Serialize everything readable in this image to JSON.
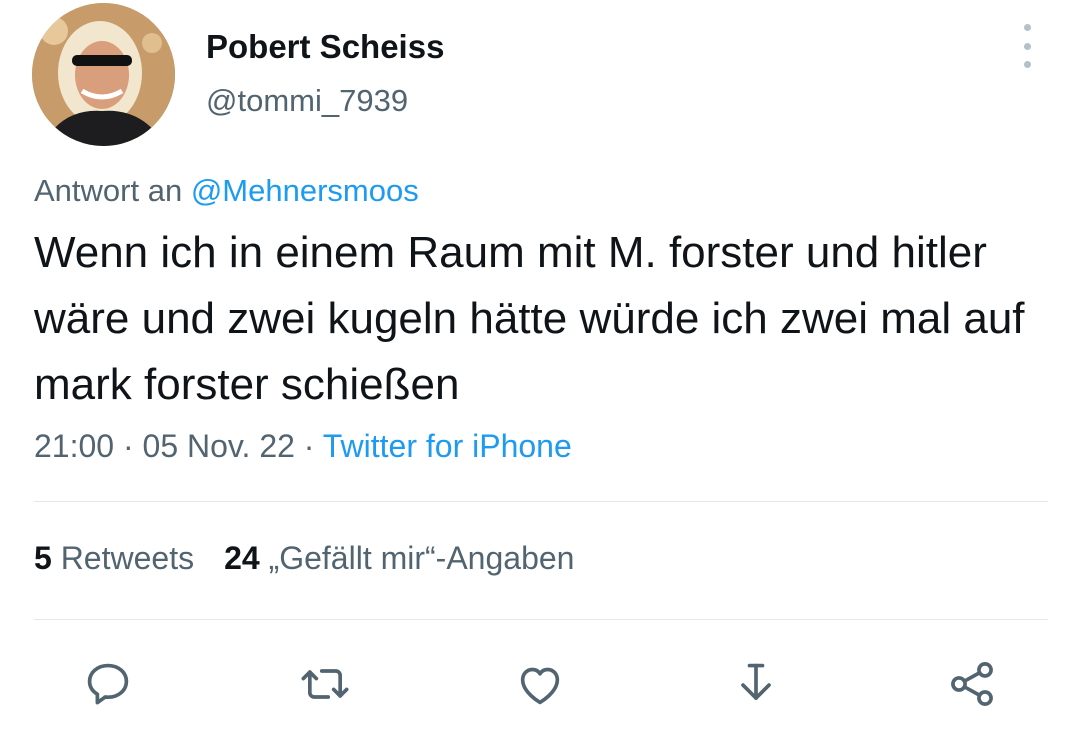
{
  "author": {
    "display_name": "Pobert Scheiss",
    "handle": "@tommi_7939"
  },
  "reply_to": {
    "prefix": "Antwort an",
    "mention": "@Mehnersmoos"
  },
  "tweet": {
    "text": "Wenn ich in einem Raum mit M. forster und hitler wäre und zwei kugeln hätte würde ich zwei mal auf mark forster schießen"
  },
  "meta": {
    "time": "21:00",
    "separator": "·",
    "date": "05 Nov. 22",
    "source": "Twitter for iPhone"
  },
  "stats": {
    "retweets_count": "5",
    "retweets_label": "Retweets",
    "likes_count": "24",
    "likes_label": "„Gefällt mir“-Angaben"
  },
  "actions": [
    {
      "icon": "reply-icon"
    },
    {
      "icon": "retweet-icon"
    },
    {
      "icon": "like-icon"
    },
    {
      "icon": "download-icon"
    },
    {
      "icon": "share-icon"
    }
  ],
  "colors": {
    "accent": "#1d9bf0",
    "secondary_text": "#536471",
    "primary_text": "#0f1419",
    "icon": "#536471",
    "divider": "#e3e8ec"
  }
}
